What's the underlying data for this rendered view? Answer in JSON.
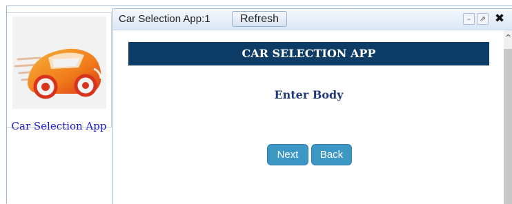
{
  "sidebar": {
    "app_tile": {
      "label": "Car Selection App",
      "logo_icon": "sports-car-logo-icon"
    }
  },
  "panel": {
    "title": "Car Selection App:1",
    "refresh_label": "Refresh",
    "controls": {
      "minimize": "–",
      "popout": "⇗",
      "close": "✖"
    },
    "scroll_up": "^"
  },
  "content": {
    "banner": "CAR SELECTION APP",
    "prompt": "Enter Body",
    "next_label": "Next",
    "back_label": "Back"
  },
  "colors": {
    "banner_bg": "#0d3d66",
    "prompt_text": "#1f3a7a",
    "button_bg": "#3d97c4",
    "tile_label": "#1a1acc",
    "logo_orange": "#f07a1a",
    "logo_red": "#d8331c"
  }
}
